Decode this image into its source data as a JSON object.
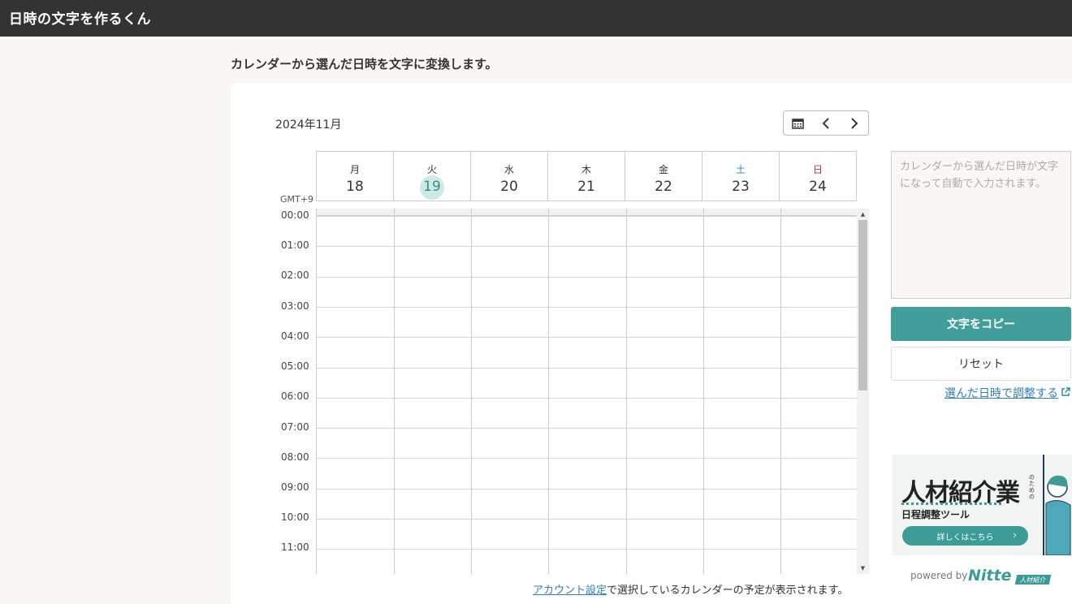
{
  "app": {
    "title": "日時の文字を作るくん"
  },
  "page": {
    "subtitle": "カレンダーから選んだ日時を文字に変換します。"
  },
  "calendar": {
    "month_label": "2024年11月",
    "timezone": "GMT+9",
    "today_index": 1,
    "days": [
      {
        "dow": "月",
        "date": "18"
      },
      {
        "dow": "火",
        "date": "19"
      },
      {
        "dow": "水",
        "date": "20"
      },
      {
        "dow": "木",
        "date": "21"
      },
      {
        "dow": "金",
        "date": "22"
      },
      {
        "dow": "土",
        "date": "23"
      },
      {
        "dow": "日",
        "date": "24"
      }
    ],
    "times": [
      "00:00",
      "01:00",
      "02:00",
      "03:00",
      "04:00",
      "05:00",
      "06:00",
      "07:00",
      "08:00",
      "09:00",
      "10:00",
      "11:00"
    ],
    "nav": {
      "calendar_icon": "calendar-icon",
      "prev_icon": "chevron-left-icon",
      "next_icon": "chevron-right-icon"
    }
  },
  "output": {
    "placeholder": "カレンダーから選んだ日時が文字になって自動で入力されます。",
    "value": ""
  },
  "actions": {
    "copy_label": "文字をコピー",
    "reset_label": "リセット",
    "adjust_link": "選んだ日時で調整する",
    "external_icon": "external-link-icon"
  },
  "ad": {
    "title": "人材紹介業",
    "for_text": "のための",
    "subtitle": "日程調整ツール",
    "cta": "詳しくはこちら",
    "powered_by": "powered by",
    "brand": "Nitte",
    "brand_badge": "人材紹介"
  },
  "footnote": {
    "link": "アカウント設定",
    "text": "で選択しているカレンダーの予定が表示されます。"
  },
  "colors": {
    "topbar": "#333333",
    "accent": "#419e9b",
    "today_bg": "#cde9e6",
    "saturday": "#2f7fc1",
    "sunday": "#c0392b",
    "link": "#2f7fc1"
  }
}
